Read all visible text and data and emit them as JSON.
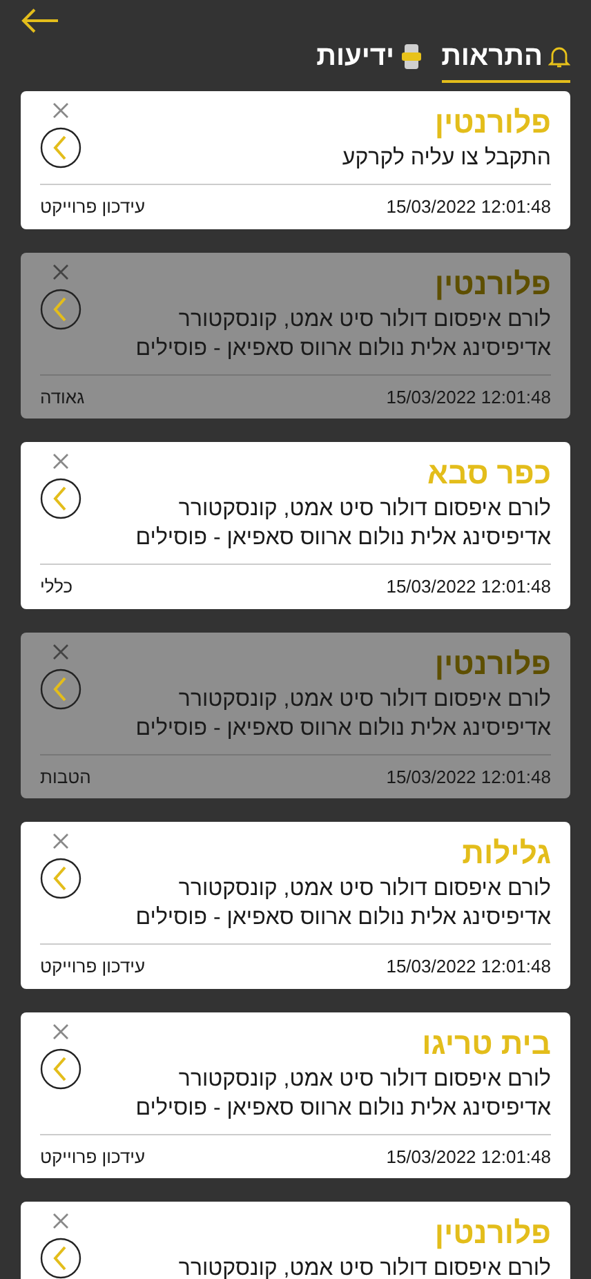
{
  "tabs": [
    {
      "label": "התראות",
      "kind": "bell",
      "selected": true
    },
    {
      "label": "ידיעות",
      "kind": "news",
      "selected": false
    }
  ],
  "notifications": [
    {
      "title": "פלורנטין",
      "lines": [
        "התקבל צו עליה לקרקע"
      ],
      "time": "15/03/2022 12:01:48",
      "category": "עידכון פרוייקט",
      "read": false
    },
    {
      "title": "פלורנטין",
      "lines": [
        "לורם איפסום דולור סיט אמט, קונסקטורר",
        "אדיפיסינג אלית נולום ארווס סאפיאן - פוסילים"
      ],
      "time": "15/03/2022 12:01:48",
      "category": "גאודה",
      "read": true
    },
    {
      "title": "כפר סבא",
      "lines": [
        "לורם איפסום דולור סיט אמט, קונסקטורר",
        "אדיפיסינג אלית נולום ארווס סאפיאן - פוסילים"
      ],
      "time": "15/03/2022 12:01:48",
      "category": "כללי",
      "read": false
    },
    {
      "title": "פלורנטין",
      "lines": [
        "לורם איפסום דולור סיט אמט, קונסקטורר",
        "אדיפיסינג אלית נולום ארווס סאפיאן - פוסילים"
      ],
      "time": "15/03/2022 12:01:48",
      "category": "הטבות",
      "read": true
    },
    {
      "title": "גלילות",
      "lines": [
        "לורם איפסום דולור סיט אמט, קונסקטורר",
        "אדיפיסינג אלית נולום ארווס סאפיאן - פוסילים"
      ],
      "time": "15/03/2022 12:01:48",
      "category": "עידכון פרוייקט",
      "read": false
    },
    {
      "title": "בית טריגו",
      "lines": [
        "לורם איפסום דולור סיט אמט, קונסקטורר",
        "אדיפיסינג אלית נולום ארווס סאפיאן - פוסילים"
      ],
      "time": "15/03/2022 12:01:48",
      "category": "עידכון פרוייקט",
      "read": false
    },
    {
      "title": "פלורנטין",
      "lines": [
        "לורם איפסום דולור סיט אמט, קונסקטורר"
      ],
      "read": false
    }
  ]
}
